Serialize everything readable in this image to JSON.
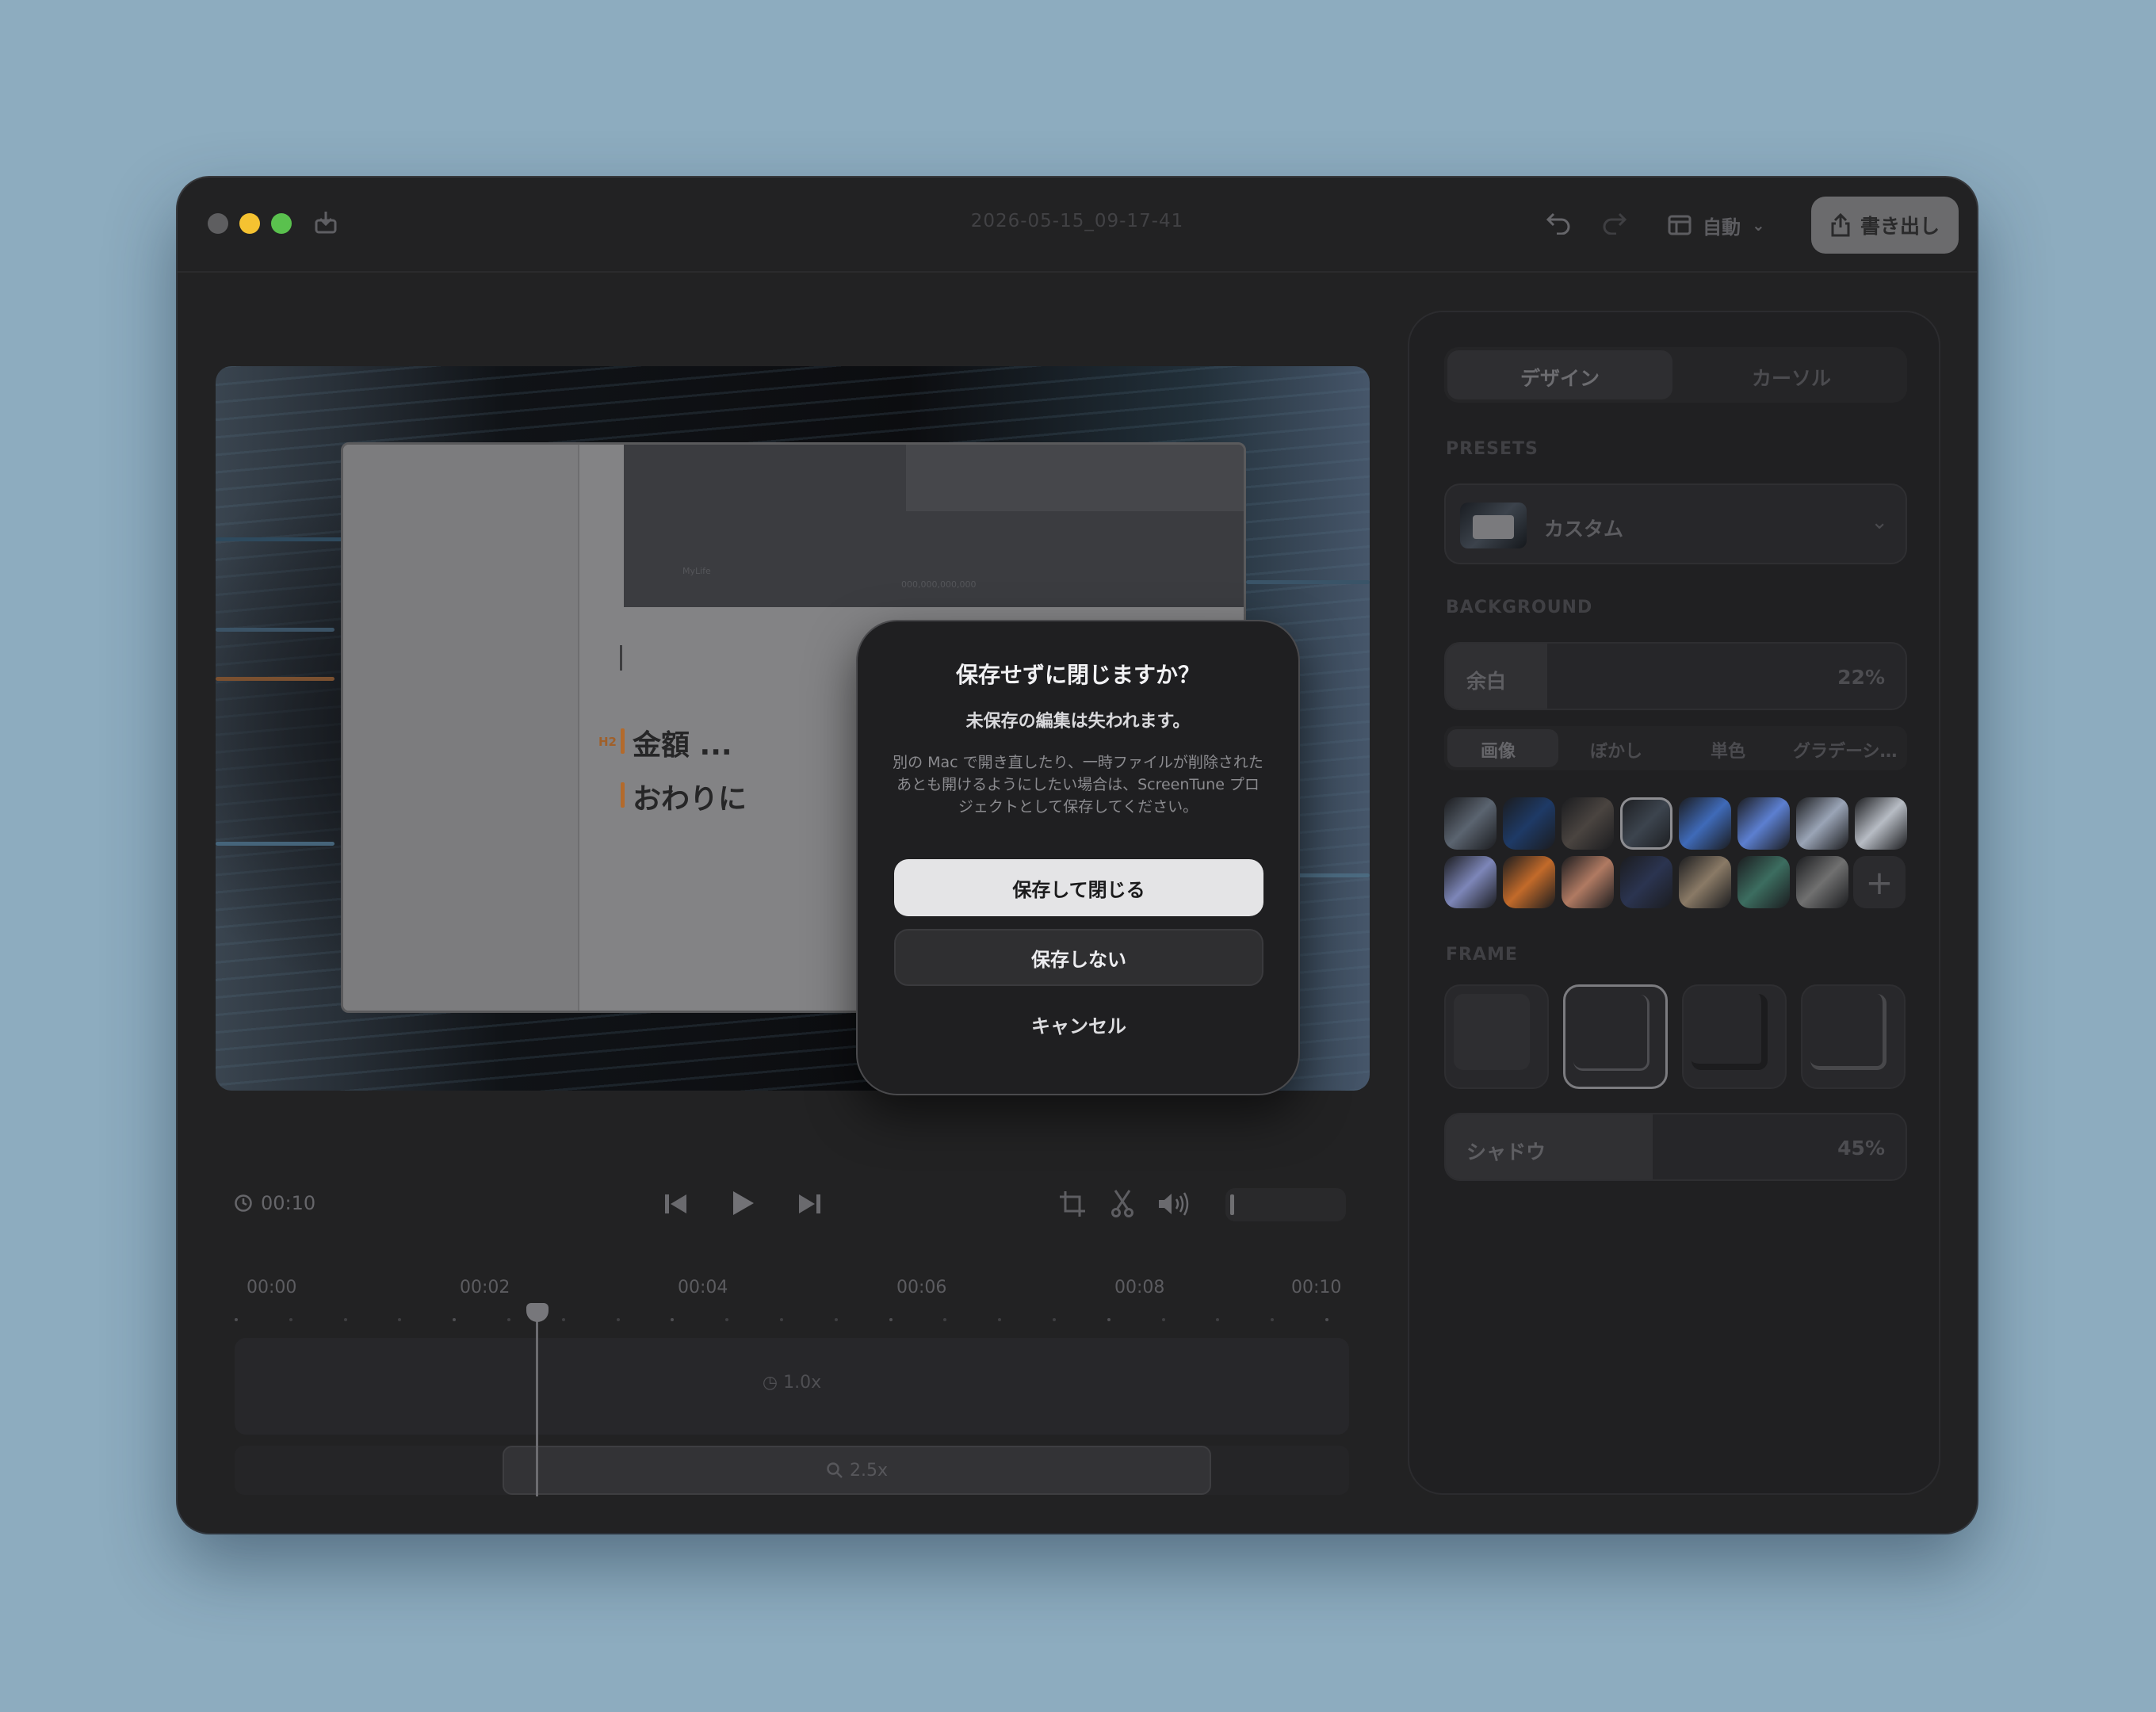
{
  "window": {
    "document_title": "2026-05-15_09-17-41",
    "layout_mode": "自動",
    "export_label": "書き出し"
  },
  "preview": {
    "heading_tag": "H2",
    "heading_1": "金額 ...",
    "heading_2": "おわりに",
    "inner_small_1": "MyLife",
    "inner_small_2": "000,000,000,000"
  },
  "dialog": {
    "title": "保存せずに閉じますか？",
    "subtitle": "未保存の編集は失われます。",
    "body": "別の Mac で開き直したり、一時ファイルが削除されたあとも開けるようにしたい場合は、ScreenTune プロジェクトとして保存してください。",
    "save_close": "保存して閉じる",
    "dont_save": "保存しない",
    "cancel": "キャンセル"
  },
  "transport": {
    "duration": "00:10",
    "volume_level": 0.03
  },
  "timeline": {
    "ticks": [
      "00:00",
      "00:02",
      "00:04",
      "00:06",
      "00:08",
      "00:10"
    ],
    "speed_label": "1.0x",
    "zoom_label": "2.5x",
    "playhead_time": "00:02.5"
  },
  "panel": {
    "tabs": [
      "デザイン",
      "カーソル"
    ],
    "active_tab": "デザイン",
    "presets_title": "PRESETS",
    "preset_name": "カスタム",
    "background_title": "BACKGROUND",
    "padding_label": "余白",
    "padding_value": "22%",
    "padding_fraction": 0.22,
    "bg_tabs": [
      "画像",
      "ぼかし",
      "単色",
      "グラデーシ…"
    ],
    "active_bg_tab": "画像",
    "swatches": [
      "#5b6470",
      "#1e3a66",
      "#4a4440",
      "#3c444e",
      "#3f6ab8",
      "#5c7fd0",
      "#9aa4b6",
      "#b7bcc4",
      "#7d86b8",
      "#c26a2a",
      "#b07a62",
      "#2b3450",
      "#8a7a66",
      "#3c6d60",
      "#707070"
    ],
    "selected_swatch": 3,
    "frame_title": "FRAME",
    "selected_frame": 1,
    "shadow_label": "シャドウ",
    "shadow_value": "45%",
    "shadow_fraction": 0.45
  }
}
